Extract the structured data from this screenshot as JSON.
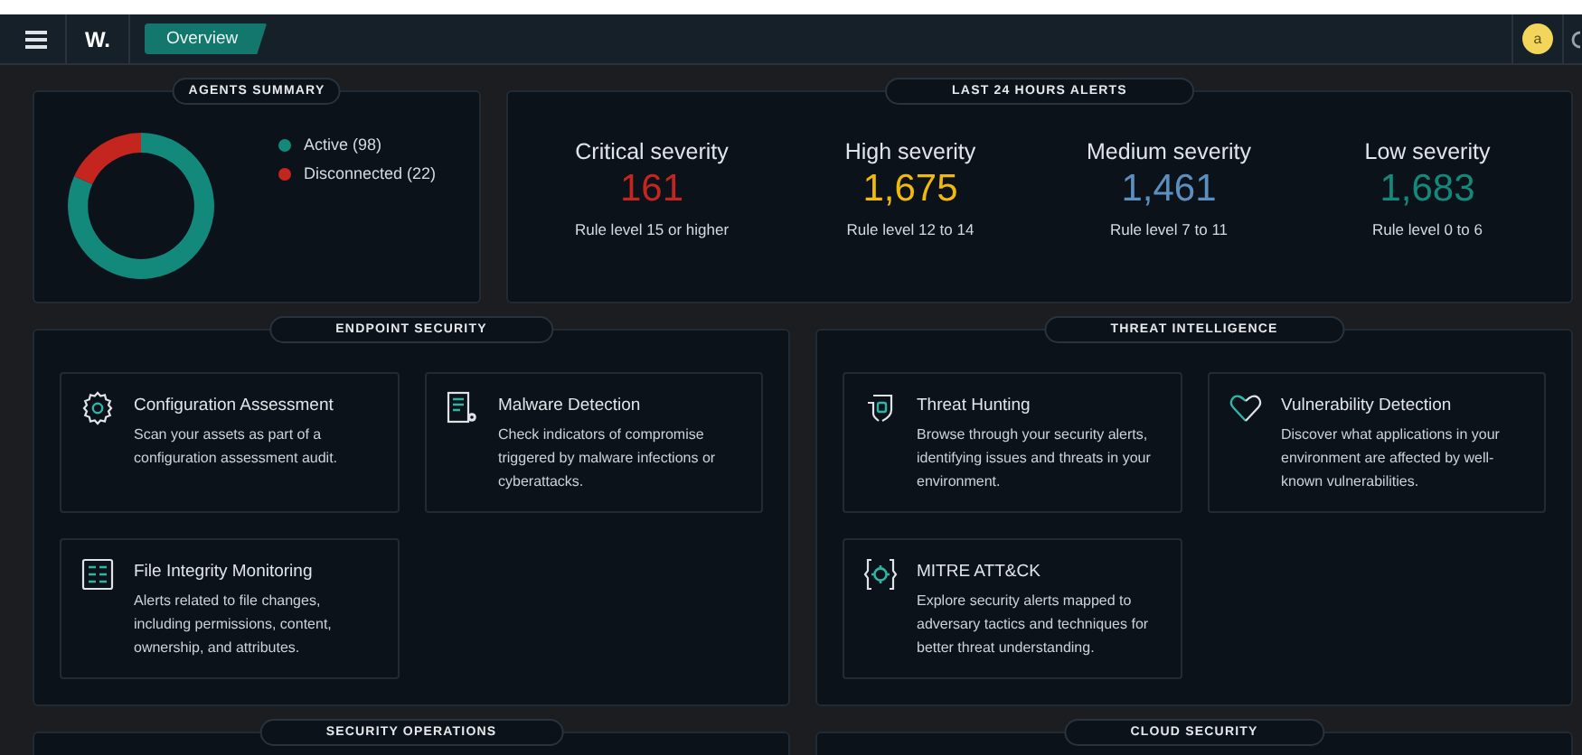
{
  "header": {
    "logo": "W.",
    "tab": {
      "label": "Overview",
      "selected": true
    },
    "avatar": "a"
  },
  "agents_summary": {
    "title": "AGENTS SUMMARY",
    "legend": [
      {
        "label": "Active (98)",
        "color": "#13897c"
      },
      {
        "label": "Disconnected (22)",
        "color": "#c4261f"
      }
    ],
    "chart_data": {
      "type": "donut",
      "values": [
        81.67,
        18.33
      ]
    }
  },
  "alerts": {
    "title": "LAST 24 HOURS ALERTS",
    "items": [
      {
        "label": "Critical severity",
        "value": "161",
        "color": "#c4261f",
        "rule": "Rule level 15 or higher"
      },
      {
        "label": "High severity",
        "value": "1,675",
        "color": "#f0b90b",
        "rule": "Rule level 12 to 14"
      },
      {
        "label": "Medium severity",
        "value": "1,461",
        "color": "#5b8fbf",
        "rule": "Rule level 7 to 11"
      },
      {
        "label": "Low severity",
        "value": "1,683",
        "color": "#13897c",
        "rule": "Rule level 0 to 6"
      }
    ]
  },
  "sections": [
    {
      "title": "ENDPOINT SECURITY",
      "cards": [
        {
          "kind": "gear",
          "title": "Configuration Assessment",
          "description": "Scan your assets as part of a configuration assessment audit."
        },
        {
          "kind": "docgear",
          "title": "Malware Detection",
          "description": "Check indicators of compromise triggered by malware infections or cyberattacks."
        },
        {
          "kind": "list",
          "title": "File Integrity Monitoring",
          "description": "Alerts related to file changes, including permissions, content, ownership, and attributes."
        }
      ]
    },
    {
      "title": "THREAT INTELLIGENCE",
      "cards": [
        {
          "kind": "shield",
          "title": "Threat Hunting",
          "description": "Browse through your security alerts, identifying issues and threats in your environment."
        },
        {
          "kind": "heart",
          "title": "Vulnerability Detection",
          "description": "Discover what applications in your environment are affected by well-known vulnerabilities."
        },
        {
          "kind": "target",
          "title": "MITRE ATT&CK",
          "description": "Explore security alerts mapped to adversary tactics and techniques for better threat understanding."
        }
      ]
    },
    {
      "title": "SECURITY OPERATIONS"
    },
    {
      "title": "CLOUD SECURITY"
    }
  ]
}
